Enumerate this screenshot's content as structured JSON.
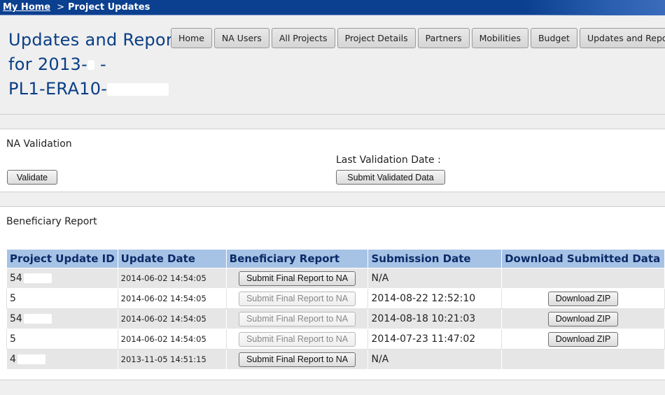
{
  "breadcrumb": {
    "home": "My Home",
    "separator": ">",
    "current": "Project Updates"
  },
  "title": {
    "line1": "Updates and Reports",
    "line2": "for 2013-",
    "line2_tail": " -",
    "line3": "PL1-ERA10-"
  },
  "nav": [
    "Home",
    "NA Users",
    "All Projects",
    "Project Details",
    "Partners",
    "Mobilities",
    "Budget",
    "Updates and Reports"
  ],
  "validation": {
    "title": "NA Validation",
    "validate_button": "Validate",
    "last_validation_label": "Last Validation Date :",
    "submit_button": "Submit Validated Data"
  },
  "report": {
    "title": "Beneficiary Report",
    "columns": [
      "Project Update ID",
      "Update Date",
      "Beneficiary Report",
      "Submission Date",
      "Download Submitted Data"
    ],
    "rows": [
      {
        "id": "54",
        "update_date": "2014-06-02 14:54:05",
        "report_button": "Submit Final Report to NA",
        "report_enabled": true,
        "submission_date": "N/A",
        "download": ""
      },
      {
        "id": "5",
        "update_date": "2014-06-02 14:54:05",
        "report_button": "Submit Final Report to NA",
        "report_enabled": false,
        "submission_date": "2014-08-22 12:52:10",
        "download": "Download ZIP"
      },
      {
        "id": "54",
        "update_date": "2014-06-02 14:54:05",
        "report_button": "Submit Final Report to NA",
        "report_enabled": false,
        "submission_date": "2014-08-18 10:21:03",
        "download": "Download ZIP"
      },
      {
        "id": "5",
        "update_date": "2014-06-02 14:54:05",
        "report_button": "Submit Final Report to NA",
        "report_enabled": false,
        "submission_date": "2014-07-23 11:47:02",
        "download": "Download ZIP"
      },
      {
        "id": "4",
        "update_date": "2013-11-05 14:51:15",
        "report_button": "Submit Final Report to NA",
        "report_enabled": true,
        "submission_date": "N/A",
        "download": ""
      }
    ]
  },
  "colors": {
    "topbar": "#0b3f8f",
    "title": "#0a3e86",
    "table_header": "#a6c3e6"
  }
}
